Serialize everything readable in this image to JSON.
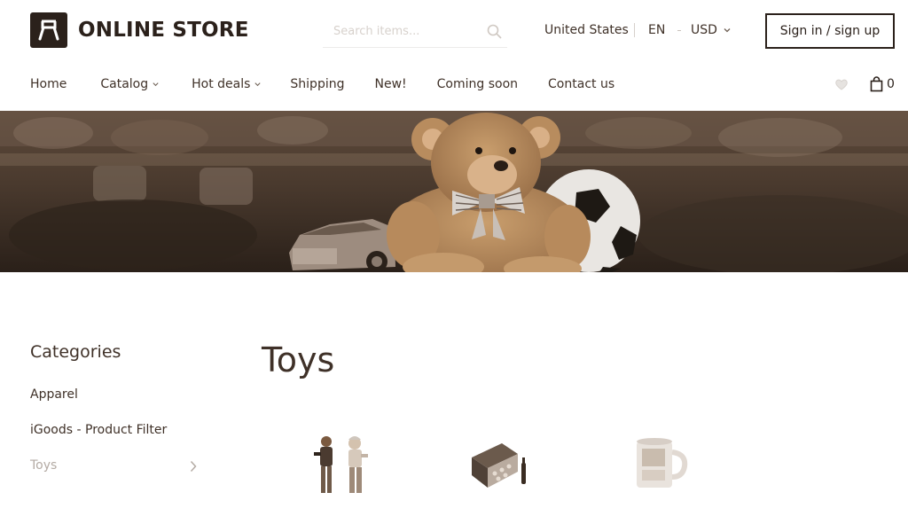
{
  "header": {
    "logo_text": "ONLINE STORE",
    "search_placeholder": "Search items...",
    "country": "United States",
    "language": "EN",
    "currency": "USD",
    "signin_label": "Sign in / sign up"
  },
  "nav": {
    "items": [
      {
        "label": "Home",
        "has_dropdown": false
      },
      {
        "label": "Catalog",
        "has_dropdown": true
      },
      {
        "label": "Hot deals",
        "has_dropdown": true
      },
      {
        "label": "Shipping",
        "has_dropdown": false
      },
      {
        "label": "New!",
        "has_dropdown": false
      },
      {
        "label": "Coming soon",
        "has_dropdown": false
      },
      {
        "label": "Contact us",
        "has_dropdown": false
      }
    ],
    "cart_count": "0",
    "wishlist_icon": "heart-icon",
    "cart_icon": "shopping-bag-icon"
  },
  "sidebar": {
    "title": "Categories",
    "items": [
      {
        "label": "Apparel",
        "active": false
      },
      {
        "label": "iGoods - Product Filter",
        "active": false
      },
      {
        "label": "Toys",
        "active": true
      }
    ]
  },
  "main": {
    "page_title": "Toys"
  },
  "colors": {
    "text": "#3f3128",
    "brand_dark": "#2b211b",
    "muted": "#b4aba4",
    "banner_tone": "#6b5443"
  }
}
